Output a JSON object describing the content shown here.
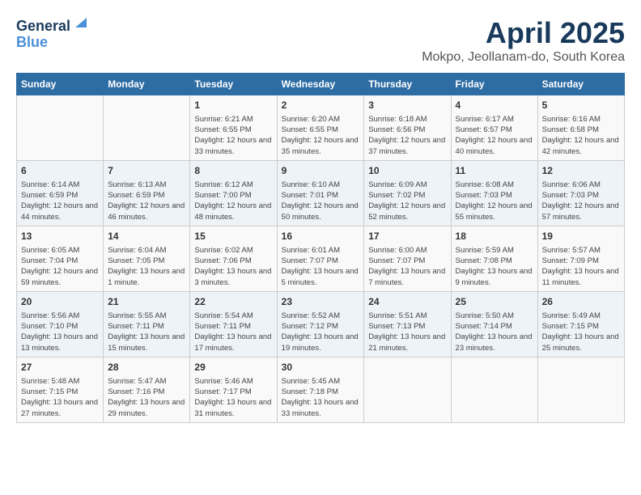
{
  "logo": {
    "general": "General",
    "blue": "Blue"
  },
  "title": "April 2025",
  "location": "Mokpo, Jeollanam-do, South Korea",
  "days_header": [
    "Sunday",
    "Monday",
    "Tuesday",
    "Wednesday",
    "Thursday",
    "Friday",
    "Saturday"
  ],
  "weeks": [
    [
      {
        "day": "",
        "sunrise": "",
        "sunset": "",
        "daylight": ""
      },
      {
        "day": "",
        "sunrise": "",
        "sunset": "",
        "daylight": ""
      },
      {
        "day": "1",
        "sunrise": "Sunrise: 6:21 AM",
        "sunset": "Sunset: 6:55 PM",
        "daylight": "Daylight: 12 hours and 33 minutes."
      },
      {
        "day": "2",
        "sunrise": "Sunrise: 6:20 AM",
        "sunset": "Sunset: 6:55 PM",
        "daylight": "Daylight: 12 hours and 35 minutes."
      },
      {
        "day": "3",
        "sunrise": "Sunrise: 6:18 AM",
        "sunset": "Sunset: 6:56 PM",
        "daylight": "Daylight: 12 hours and 37 minutes."
      },
      {
        "day": "4",
        "sunrise": "Sunrise: 6:17 AM",
        "sunset": "Sunset: 6:57 PM",
        "daylight": "Daylight: 12 hours and 40 minutes."
      },
      {
        "day": "5",
        "sunrise": "Sunrise: 6:16 AM",
        "sunset": "Sunset: 6:58 PM",
        "daylight": "Daylight: 12 hours and 42 minutes."
      }
    ],
    [
      {
        "day": "6",
        "sunrise": "Sunrise: 6:14 AM",
        "sunset": "Sunset: 6:59 PM",
        "daylight": "Daylight: 12 hours and 44 minutes."
      },
      {
        "day": "7",
        "sunrise": "Sunrise: 6:13 AM",
        "sunset": "Sunset: 6:59 PM",
        "daylight": "Daylight: 12 hours and 46 minutes."
      },
      {
        "day": "8",
        "sunrise": "Sunrise: 6:12 AM",
        "sunset": "Sunset: 7:00 PM",
        "daylight": "Daylight: 12 hours and 48 minutes."
      },
      {
        "day": "9",
        "sunrise": "Sunrise: 6:10 AM",
        "sunset": "Sunset: 7:01 PM",
        "daylight": "Daylight: 12 hours and 50 minutes."
      },
      {
        "day": "10",
        "sunrise": "Sunrise: 6:09 AM",
        "sunset": "Sunset: 7:02 PM",
        "daylight": "Daylight: 12 hours and 52 minutes."
      },
      {
        "day": "11",
        "sunrise": "Sunrise: 6:08 AM",
        "sunset": "Sunset: 7:03 PM",
        "daylight": "Daylight: 12 hours and 55 minutes."
      },
      {
        "day": "12",
        "sunrise": "Sunrise: 6:06 AM",
        "sunset": "Sunset: 7:03 PM",
        "daylight": "Daylight: 12 hours and 57 minutes."
      }
    ],
    [
      {
        "day": "13",
        "sunrise": "Sunrise: 6:05 AM",
        "sunset": "Sunset: 7:04 PM",
        "daylight": "Daylight: 12 hours and 59 minutes."
      },
      {
        "day": "14",
        "sunrise": "Sunrise: 6:04 AM",
        "sunset": "Sunset: 7:05 PM",
        "daylight": "Daylight: 13 hours and 1 minute."
      },
      {
        "day": "15",
        "sunrise": "Sunrise: 6:02 AM",
        "sunset": "Sunset: 7:06 PM",
        "daylight": "Daylight: 13 hours and 3 minutes."
      },
      {
        "day": "16",
        "sunrise": "Sunrise: 6:01 AM",
        "sunset": "Sunset: 7:07 PM",
        "daylight": "Daylight: 13 hours and 5 minutes."
      },
      {
        "day": "17",
        "sunrise": "Sunrise: 6:00 AM",
        "sunset": "Sunset: 7:07 PM",
        "daylight": "Daylight: 13 hours and 7 minutes."
      },
      {
        "day": "18",
        "sunrise": "Sunrise: 5:59 AM",
        "sunset": "Sunset: 7:08 PM",
        "daylight": "Daylight: 13 hours and 9 minutes."
      },
      {
        "day": "19",
        "sunrise": "Sunrise: 5:57 AM",
        "sunset": "Sunset: 7:09 PM",
        "daylight": "Daylight: 13 hours and 11 minutes."
      }
    ],
    [
      {
        "day": "20",
        "sunrise": "Sunrise: 5:56 AM",
        "sunset": "Sunset: 7:10 PM",
        "daylight": "Daylight: 13 hours and 13 minutes."
      },
      {
        "day": "21",
        "sunrise": "Sunrise: 5:55 AM",
        "sunset": "Sunset: 7:11 PM",
        "daylight": "Daylight: 13 hours and 15 minutes."
      },
      {
        "day": "22",
        "sunrise": "Sunrise: 5:54 AM",
        "sunset": "Sunset: 7:11 PM",
        "daylight": "Daylight: 13 hours and 17 minutes."
      },
      {
        "day": "23",
        "sunrise": "Sunrise: 5:52 AM",
        "sunset": "Sunset: 7:12 PM",
        "daylight": "Daylight: 13 hours and 19 minutes."
      },
      {
        "day": "24",
        "sunrise": "Sunrise: 5:51 AM",
        "sunset": "Sunset: 7:13 PM",
        "daylight": "Daylight: 13 hours and 21 minutes."
      },
      {
        "day": "25",
        "sunrise": "Sunrise: 5:50 AM",
        "sunset": "Sunset: 7:14 PM",
        "daylight": "Daylight: 13 hours and 23 minutes."
      },
      {
        "day": "26",
        "sunrise": "Sunrise: 5:49 AM",
        "sunset": "Sunset: 7:15 PM",
        "daylight": "Daylight: 13 hours and 25 minutes."
      }
    ],
    [
      {
        "day": "27",
        "sunrise": "Sunrise: 5:48 AM",
        "sunset": "Sunset: 7:15 PM",
        "daylight": "Daylight: 13 hours and 27 minutes."
      },
      {
        "day": "28",
        "sunrise": "Sunrise: 5:47 AM",
        "sunset": "Sunset: 7:16 PM",
        "daylight": "Daylight: 13 hours and 29 minutes."
      },
      {
        "day": "29",
        "sunrise": "Sunrise: 5:46 AM",
        "sunset": "Sunset: 7:17 PM",
        "daylight": "Daylight: 13 hours and 31 minutes."
      },
      {
        "day": "30",
        "sunrise": "Sunrise: 5:45 AM",
        "sunset": "Sunset: 7:18 PM",
        "daylight": "Daylight: 13 hours and 33 minutes."
      },
      {
        "day": "",
        "sunrise": "",
        "sunset": "",
        "daylight": ""
      },
      {
        "day": "",
        "sunrise": "",
        "sunset": "",
        "daylight": ""
      },
      {
        "day": "",
        "sunrise": "",
        "sunset": "",
        "daylight": ""
      }
    ]
  ]
}
